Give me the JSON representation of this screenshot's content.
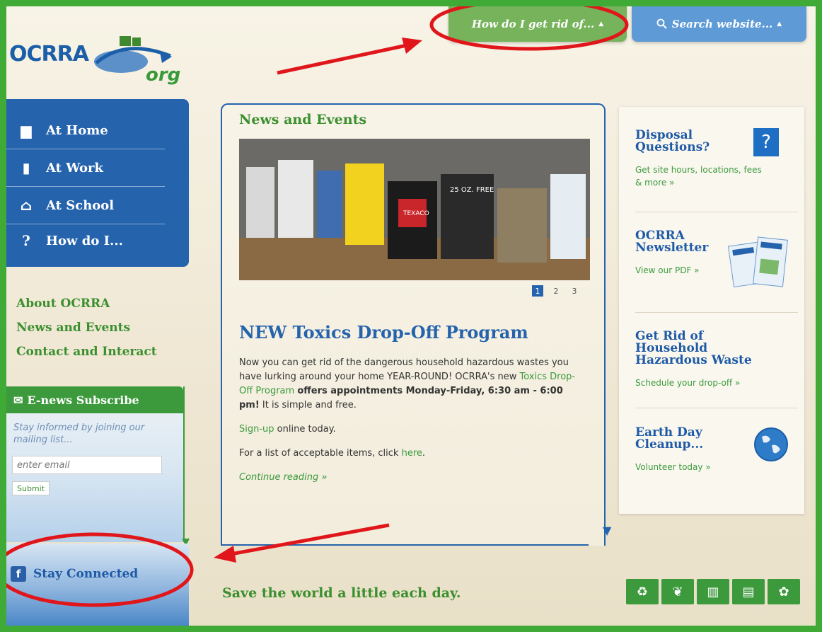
{
  "logo": {
    "main": "OCRRA",
    "suffix": "org"
  },
  "top_buttons": {
    "how_do_i": "How do I get rid of...",
    "search": "Search website..."
  },
  "nav": {
    "items": [
      {
        "label": "At Home",
        "icon": "house-icon"
      },
      {
        "label": "At Work",
        "icon": "building-icon"
      },
      {
        "label": "At School",
        "icon": "school-icon"
      },
      {
        "label": "How do I...",
        "icon": "question-icon"
      }
    ]
  },
  "sub_links": [
    "About OCRRA",
    "News and Events",
    "Contact and Interact"
  ],
  "enews": {
    "title": "E-news Subscribe",
    "text": "Stay informed by joining our mailing list...",
    "placeholder": "enter email",
    "submit": "Submit"
  },
  "connect": {
    "label": "Stay Connected"
  },
  "news": {
    "heading": "News and Events",
    "pages": [
      "1",
      "2",
      "3"
    ],
    "active_page": "1",
    "title": "NEW Toxics Drop-Off Program",
    "body_1": "Now you can get rid of the dangerous household hazardous wastes you have lurking around your home YEAR-ROUND! OCRRA's new ",
    "body_link": "Toxics Drop-Off Program",
    "body_bold": "offers appointments Monday-Friday, 6:30 am - 6:00 pm!",
    "body_2": " It is simple and free.",
    "signup_link": "Sign-up",
    "signup_text": " online today.",
    "list_text": "For a list of acceptable items, click ",
    "here_link": "here",
    "list_end": ".",
    "more": "Continue reading »",
    "image_labels": [
      "25 OZ. FREE",
      "TEXACO"
    ]
  },
  "right": {
    "cards": [
      {
        "title": "Disposal Questions?",
        "link": "Get site hours, locations, fees & more »"
      },
      {
        "title": "OCRRA Newsletter",
        "link": "View our PDF »"
      },
      {
        "title": "Get Rid of Household Hazardous Waste",
        "link": "Schedule your drop-off »"
      },
      {
        "title": "Earth Day Cleanup...",
        "link": "Volunteer today »"
      }
    ],
    "question_mark": "?"
  },
  "footer": {
    "tagline": "Save the world a little each day.",
    "icons": [
      "recycle-icon",
      "leaf-icon",
      "trash-icon",
      "compost-icon",
      "yard-icon"
    ]
  },
  "colors": {
    "green": "#3faa35",
    "blue": "#2563ad",
    "annotation": "#e0161b"
  }
}
